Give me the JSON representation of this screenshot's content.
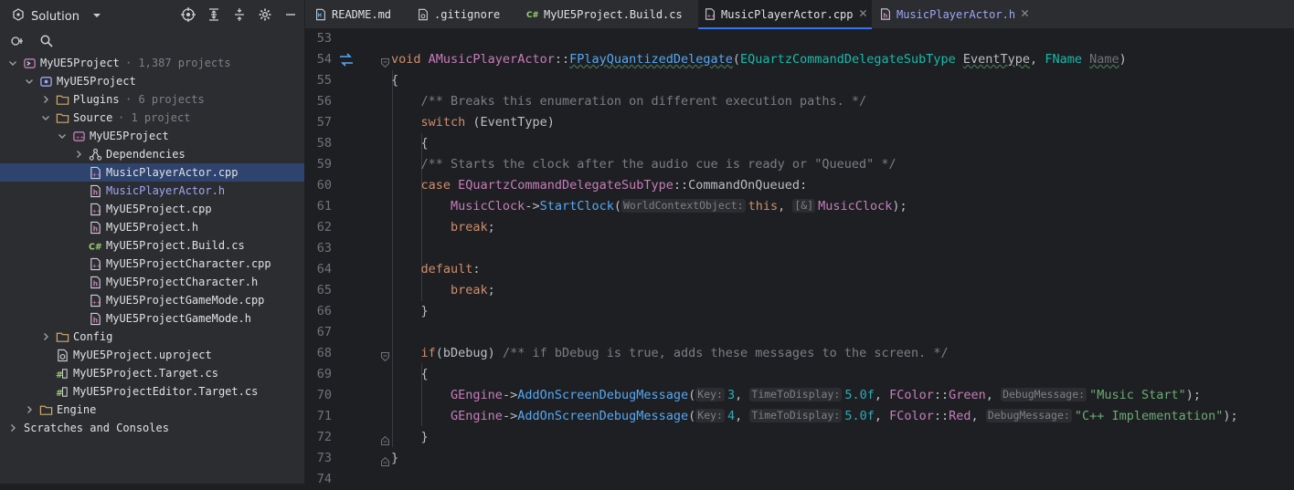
{
  "panel": {
    "title": "Solution"
  },
  "tree": [
    {
      "label": "MyUE5Project",
      "sub": "· 1,387 projects",
      "depth": 0,
      "chev": "down",
      "icon": "solution-icon"
    },
    {
      "label": "MyUE5Project",
      "sub": "",
      "depth": 1,
      "chev": "down",
      "icon": "uproject-icon"
    },
    {
      "label": "Plugins",
      "sub": "· 6 projects",
      "depth": 2,
      "chev": "right",
      "icon": "folder-icon"
    },
    {
      "label": "Source",
      "sub": "· 1 project",
      "depth": 2,
      "chev": "down",
      "icon": "folder-icon"
    },
    {
      "label": "MyUE5Project",
      "sub": "",
      "depth": 3,
      "chev": "down",
      "icon": "cpp-project-icon"
    },
    {
      "label": "Dependencies",
      "sub": "",
      "depth": 4,
      "chev": "right",
      "icon": "dependencies-icon"
    },
    {
      "label": "MusicPlayerActor.cpp",
      "sub": "",
      "depth": 4,
      "chev": "",
      "icon": "cpp-file-icon",
      "selected": true
    },
    {
      "label": "MusicPlayerActor.h",
      "sub": "",
      "depth": 4,
      "chev": "",
      "icon": "h-file-icon",
      "hfile": true
    },
    {
      "label": "MyUE5Project.cpp",
      "sub": "",
      "depth": 4,
      "chev": "",
      "icon": "cpp-file-icon"
    },
    {
      "label": "MyUE5Project.h",
      "sub": "",
      "depth": 4,
      "chev": "",
      "icon": "h-file-icon"
    },
    {
      "label": "MyUE5Project.Build.cs",
      "sub": "",
      "depth": 4,
      "chev": "",
      "icon": "csharp-file-icon"
    },
    {
      "label": "MyUE5ProjectCharacter.cpp",
      "sub": "",
      "depth": 4,
      "chev": "",
      "icon": "cpp-file-icon"
    },
    {
      "label": "MyUE5ProjectCharacter.h",
      "sub": "",
      "depth": 4,
      "chev": "",
      "icon": "h-file-icon"
    },
    {
      "label": "MyUE5ProjectGameMode.cpp",
      "sub": "",
      "depth": 4,
      "chev": "",
      "icon": "cpp-file-icon"
    },
    {
      "label": "MyUE5ProjectGameMode.h",
      "sub": "",
      "depth": 4,
      "chev": "",
      "icon": "h-file-icon"
    },
    {
      "label": "Config",
      "sub": "",
      "depth": 2,
      "chev": "right",
      "icon": "folder-icon"
    },
    {
      "label": "MyUE5Project.uproject",
      "sub": "",
      "depth": 2,
      "chev": "",
      "icon": "uproject-file-icon"
    },
    {
      "label": "MyUE5Project.Target.cs",
      "sub": "",
      "depth": 2,
      "chev": "",
      "icon": "target-cs-icon"
    },
    {
      "label": "MyUE5ProjectEditor.Target.cs",
      "sub": "",
      "depth": 2,
      "chev": "",
      "icon": "target-cs-icon"
    },
    {
      "label": "Engine",
      "sub": "",
      "depth": 1,
      "chev": "right",
      "icon": "folder-icon"
    },
    {
      "label": "Scratches and Consoles",
      "sub": "",
      "depth": 0,
      "chev": "right",
      "icon": "scratches-icon"
    }
  ],
  "tabs": [
    {
      "label": "README.md",
      "icon": "markdown-icon",
      "active": false,
      "close": false
    },
    {
      "label": ".gitignore",
      "icon": "gitignore-icon",
      "active": false,
      "close": false
    },
    {
      "label": "MyUE5Project.Build.cs",
      "icon": "csharp-file-icon",
      "active": false,
      "close": false
    },
    {
      "label": "MusicPlayerActor.cpp",
      "icon": "cpp-file-icon",
      "active": true,
      "close": true
    },
    {
      "label": "MusicPlayerActor.h",
      "icon": "h-file-icon",
      "active": false,
      "close": true,
      "hfile": true
    }
  ],
  "code": {
    "line_numbers": [
      "53",
      "54",
      "55",
      "56",
      "57",
      "58",
      "59",
      "60",
      "61",
      "62",
      "63",
      "64",
      "65",
      "66",
      "67",
      "68",
      "69",
      "70",
      "71",
      "72",
      "73",
      "74"
    ],
    "l54": {
      "kw": "void",
      "cls": "AMusicPlayerActor",
      "sep": "::",
      "fn": "FPlayQuantizedDelegate",
      "p1type": "EQuartzCommandDelegateSubType",
      "p1": "EventType",
      "p2type": "FName",
      "p2": "Name",
      "close": ")"
    },
    "l55": "{",
    "l56": "/** Breaks this enumeration on different execution paths. */",
    "l57": {
      "kw": "switch",
      "rest": " (EventType)"
    },
    "l58": "{",
    "l59": "/** Starts the clock after the audio cue is ready or \"Queued\" */",
    "l60": {
      "kw": "case",
      "enum": "EQuartzCommandDelegateSubType",
      "sep": "::",
      "val": "CommandOnQueued",
      "colon": ":"
    },
    "l61": {
      "obj": "MusicClock",
      "arrow": "->",
      "fn": "StartClock",
      "hint1": "WorldContextObject:",
      "this": "this",
      "hint2": "[&]",
      "arg2": "MusicClock",
      "end": ");"
    },
    "l62": {
      "kw": "break",
      "end": ";"
    },
    "l64": {
      "kw": "default",
      "end": ":"
    },
    "l65": {
      "kw": "break",
      "end": ";"
    },
    "l66": "}",
    "l68": {
      "kw": "if",
      "cond": "(bDebug)",
      "cm": "/** if bDebug is true, adds these messages to the screen. */"
    },
    "l69": "{",
    "l70": {
      "obj": "GEngine",
      "arrow": "->",
      "fn": "AddOnScreenDebugMessage",
      "h1": "Key:",
      "a1": "3",
      "h2": "TimeToDisplay:",
      "a2": "5.0f",
      "cls": "FColor",
      "sep": "::",
      "col": "Green",
      "h3": "DebugMessage:",
      "str": "\"Music Start\"",
      "end": ");"
    },
    "l71": {
      "obj": "GEngine",
      "arrow": "->",
      "fn": "AddOnScreenDebugMessage",
      "h1": "Key:",
      "a1": "4",
      "h2": "TimeToDisplay:",
      "a2": "5.0f",
      "cls": "FColor",
      "sep": "::",
      "col": "Red",
      "h3": "DebugMessage:",
      "str": "\"C++ Implementation\"",
      "end": ");"
    },
    "l72": "}",
    "l73": "}"
  },
  "colors": {
    "accent": "#3574f0",
    "selection": "#2e436e",
    "keyword": "#cf8e6d",
    "function": "#56a8f5",
    "comment": "#7a7e85",
    "string": "#6aab73",
    "number": "#2aacb8"
  }
}
